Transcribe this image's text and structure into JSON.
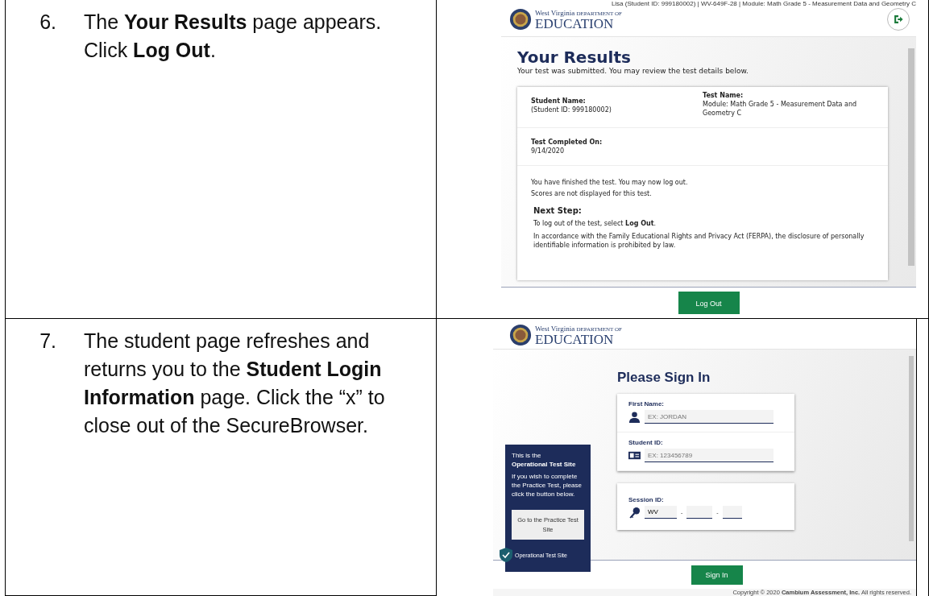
{
  "steps": [
    {
      "number": "6.",
      "text": "The **Your Results** page appears. Click **Log Out**."
    },
    {
      "number": "7.",
      "text": "The student page refreshes and returns you to the **Student Login Information** page. Click the “x” to close out of the SecureBrowser."
    }
  ],
  "results_screen": {
    "header_info": "Lisa (Student ID: 999180002) | WV-649F-28 | Module: Math Grade 5 - Measurement Data and Geometry C",
    "logo": {
      "state": "West Virginia",
      "department": "DEPARTMENT OF",
      "agency": "EDUCATION"
    },
    "title": "Your Results",
    "subtitle": "Your test was submitted. You may review the test details below.",
    "student_name_label": "Student Name:",
    "student_id": "(Student ID: 999180002)",
    "test_name_label": "Test Name:",
    "test_name": "Module: Math Grade 5 - Measurement Data and Geometry C",
    "completed_label": "Test Completed On:",
    "completed_date": "9/14/2020",
    "messages": [
      "You have finished the test. You may now log out.",
      "Scores are not displayed for this test."
    ],
    "next_step_heading": "Next Step:",
    "next_step_paragraphs": [
      "To log out of the test, select **Log Out**.",
      "In accordance with the Family Educational Rights and Privacy Act (FERPA), the disclosure of personally identifiable information is prohibited by law."
    ],
    "button": "Log Out"
  },
  "signin_screen": {
    "logo": {
      "state": "West Virginia",
      "department": "DEPARTMENT OF",
      "agency": "EDUCATION"
    },
    "title": "Please Sign In",
    "fields": [
      {
        "kind": "person",
        "label": "First Name:",
        "placeholder": "EX: JORDAN"
      },
      {
        "kind": "id-card",
        "label": "Student ID:",
        "placeholder": "EX: 123456789"
      }
    ],
    "session": {
      "label": "Session ID:",
      "prefix": "WV",
      "separators": [
        "-",
        "-"
      ]
    },
    "site_panel": {
      "intro": "This is the",
      "site": "Operational Test Site",
      "text": "If you wish to complete the Practice Test, please click the button below.",
      "button": "Go to the Practice Test Site",
      "badge": "Operational Test Site"
    },
    "button": "Sign In",
    "copyright": "Copyright © 2020 **Cambium Assessment, Inc.** All rights reserved."
  }
}
